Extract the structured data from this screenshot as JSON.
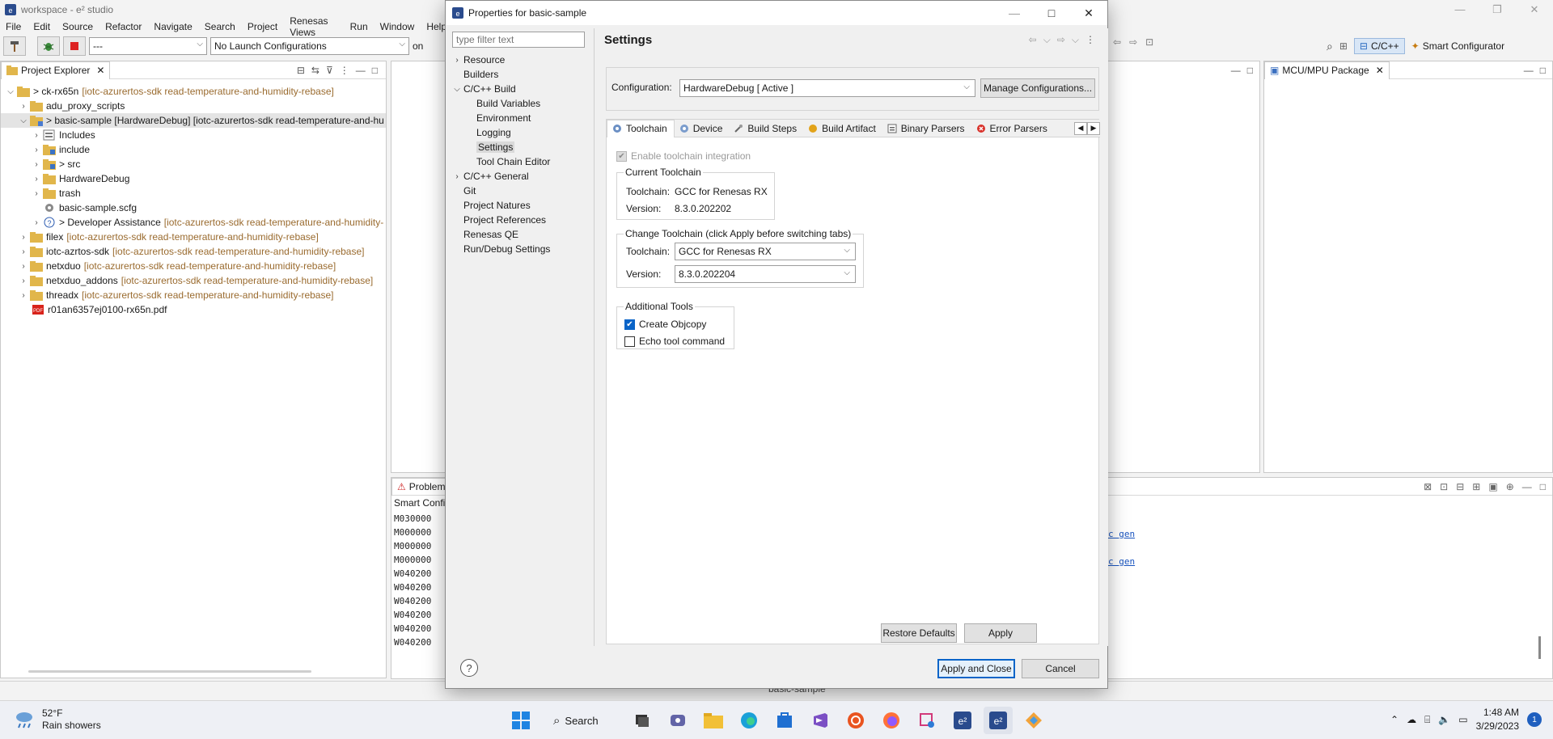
{
  "window": {
    "title": "workspace - e² studio"
  },
  "menu": [
    "File",
    "Edit",
    "Source",
    "Refactor",
    "Navigate",
    "Search",
    "Project",
    "Renesas Views",
    "Run",
    "Window",
    "Help"
  ],
  "toolbar": {
    "build_combo": "---",
    "launch_combo": "No Launch Configurations",
    "launch_target_partial": "on",
    "perspective_cpp": "C/C++",
    "perspective_smart": "Smart Configurator"
  },
  "project_explorer": {
    "tab_label": "Project Explorer",
    "items": [
      {
        "label": "> ck-rx65n",
        "decoration": "[iotc-azurertos-sdk read-temperature-and-humidity-rebase]"
      },
      {
        "label": "adu_proxy_scripts",
        "decoration": ""
      },
      {
        "label": "> basic-sample [HardwareDebug] [iotc-azurertos-sdk read-temperature-and-hu",
        "decoration": ""
      },
      {
        "label": "Includes",
        "decoration": ""
      },
      {
        "label": "include",
        "decoration": ""
      },
      {
        "label": "> src",
        "decoration": ""
      },
      {
        "label": "HardwareDebug",
        "decoration": ""
      },
      {
        "label": "trash",
        "decoration": ""
      },
      {
        "label": "basic-sample.scfg",
        "decoration": ""
      },
      {
        "label": "> Developer Assistance",
        "decoration": "[iotc-azurertos-sdk read-temperature-and-humidity-"
      },
      {
        "label": "filex",
        "decoration": "[iotc-azurertos-sdk read-temperature-and-humidity-rebase]"
      },
      {
        "label": "iotc-azrtos-sdk",
        "decoration": "[iotc-azurertos-sdk read-temperature-and-humidity-rebase]"
      },
      {
        "label": "netxduo",
        "decoration": "[iotc-azurertos-sdk read-temperature-and-humidity-rebase]"
      },
      {
        "label": "netxduo_addons",
        "decoration": "[iotc-azurertos-sdk read-temperature-and-humidity-rebase]"
      },
      {
        "label": "threadx",
        "decoration": "[iotc-azurertos-sdk read-temperature-and-humidity-rebase]"
      },
      {
        "label": "r01an6357ej0100-rx65n.pdf",
        "decoration": ""
      }
    ]
  },
  "mcu_panel": {
    "tab_label": "MCU/MPU Package"
  },
  "problems_panel": {
    "tab_label": "Problem",
    "header": "Smart Confi",
    "lines": [
      "M030000",
      "M000000",
      "M000000",
      "M000000",
      "W040200",
      "W040200",
      "W040200",
      "W040200",
      "W040200",
      "W040200"
    ],
    "link_text": "c gen"
  },
  "status_bar": {
    "selection": "basic-sample"
  },
  "dialog": {
    "title": "Properties for basic-sample",
    "filter_placeholder": "type filter text",
    "heading": "Settings",
    "nav": [
      {
        "label": "Resource"
      },
      {
        "label": "Builders"
      },
      {
        "label": "C/C++ Build"
      },
      {
        "label": "Build Variables"
      },
      {
        "label": "Environment"
      },
      {
        "label": "Logging"
      },
      {
        "label": "Settings"
      },
      {
        "label": "Tool Chain Editor"
      },
      {
        "label": "C/C++ General"
      },
      {
        "label": "Git"
      },
      {
        "label": "Project Natures"
      },
      {
        "label": "Project References"
      },
      {
        "label": "Renesas QE"
      },
      {
        "label": "Run/Debug Settings"
      }
    ],
    "configuration_label": "Configuration:",
    "configuration_value": "HardwareDebug  [ Active ]",
    "manage_button": "Manage Configurations...",
    "tabs": [
      "Toolchain",
      "Device",
      "Build Steps",
      "Build Artifact",
      "Binary Parsers",
      "Error Parsers"
    ],
    "enable_integration": "Enable toolchain integration",
    "current_group": "Current Toolchain",
    "toolchain_label": "Toolchain:",
    "version_label": "Version:",
    "current_toolchain": "GCC for Renesas RX",
    "current_version": "8.3.0.202202",
    "change_group": "Change Toolchain (click Apply before switching tabs)",
    "change_toolchain": "GCC for Renesas RX",
    "change_version": "8.3.0.202204",
    "additional_group": "Additional Tools",
    "create_objcopy": "Create Objcopy",
    "echo_tool": "Echo tool command",
    "restore_defaults": "Restore Defaults",
    "apply": "Apply",
    "apply_close": "Apply and Close",
    "cancel": "Cancel",
    "help": "?"
  },
  "taskbar": {
    "temperature": "52°F",
    "weather": "Rain showers",
    "search": "Search",
    "time": "1:48 AM",
    "date": "3/29/2023",
    "notification_count": "1"
  },
  "colors": {
    "accent": "#0a64c8",
    "decoration": "#9a6b2f",
    "taskbar": "#eef0f5"
  }
}
